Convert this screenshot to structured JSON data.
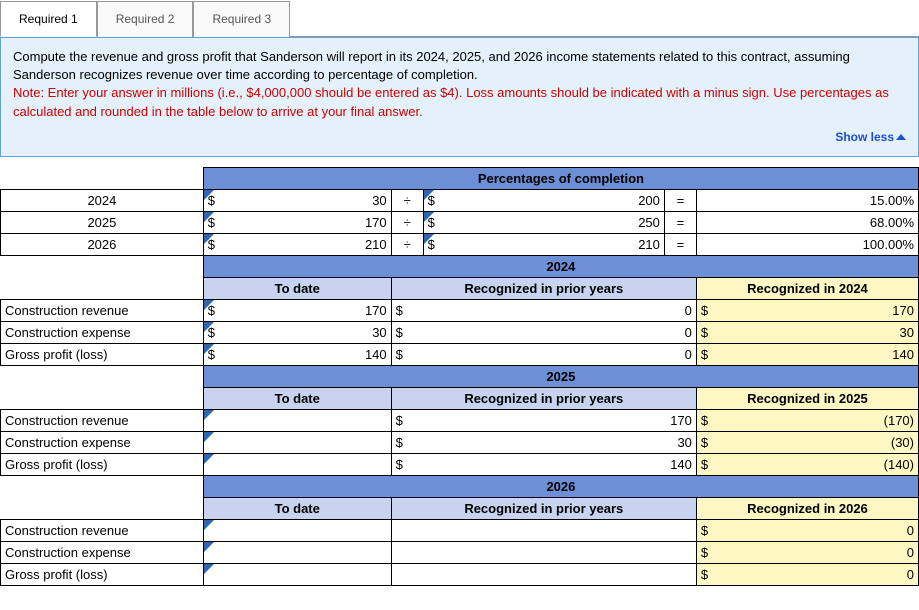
{
  "tabs": {
    "t1": "Required 1",
    "t2": "Required 2",
    "t3": "Required 3"
  },
  "prompt": {
    "p1": "Compute the revenue and gross profit that Sanderson will report in its 2024, 2025, and 2026 income statements related to this contract, assuming Sanderson recognizes revenue over time according to percentage of completion.",
    "p2": "Note: Enter your answer in millions (i.e., $4,000,000 should be entered as $4). Loss amounts should be indicated with a minus sign. Use percentages as calculated and rounded in the table below to arrive at your final answer.",
    "showless": "Show less"
  },
  "headers": {
    "poc": "Percentages of completion",
    "y2024": "2024",
    "y2025": "2025",
    "y2026": "2026",
    "todate": "To date",
    "prior": "Recognized in prior years",
    "r2024": "Recognized in 2024",
    "r2025": "Recognized in 2025",
    "r2026": "Recognized in 2026"
  },
  "rows": {
    "crev": "Construction revenue",
    "cexp": "Construction expense",
    "gp": "Gross profit (loss)"
  },
  "sym": {
    "dollar": "$",
    "div": "÷",
    "eq": "="
  },
  "poc": {
    "r24": {
      "num": "30",
      "den": "200",
      "pct": "15.00%"
    },
    "r25": {
      "num": "170",
      "den": "250",
      "pct": "68.00%"
    },
    "r26": {
      "num": "210",
      "den": "210",
      "pct": "100.00%"
    }
  },
  "y24": {
    "crev": {
      "td": "170",
      "prior": "0",
      "rec": "170"
    },
    "cexp": {
      "td": "30",
      "prior": "0",
      "rec": "30"
    },
    "gp": {
      "td": "140",
      "prior": "0",
      "rec": "140"
    }
  },
  "y25": {
    "crev": {
      "td": "",
      "prior": "170",
      "rec": "(170)"
    },
    "cexp": {
      "td": "",
      "prior": "30",
      "rec": "(30)"
    },
    "gp": {
      "td": "",
      "prior": "140",
      "rec": "(140)"
    }
  },
  "y26": {
    "crev": {
      "td": "",
      "prior": "",
      "rec": "0"
    },
    "cexp": {
      "td": "",
      "prior": "",
      "rec": "0"
    },
    "gp": {
      "td": "",
      "prior": "",
      "rec": "0"
    }
  },
  "chart_data": {
    "type": "table",
    "title": "Percentages of completion and recognized amounts by year",
    "poc": [
      {
        "year": 2024,
        "numerator": 30,
        "denominator": 200,
        "percent": 15.0
      },
      {
        "year": 2025,
        "numerator": 170,
        "denominator": 250,
        "percent": 68.0
      },
      {
        "year": 2026,
        "numerator": 210,
        "denominator": 210,
        "percent": 100.0
      }
    ],
    "revenue_profit": [
      {
        "year": 2024,
        "category": "Construction revenue",
        "to_date": 170,
        "prior": 0,
        "recognized": 170
      },
      {
        "year": 2024,
        "category": "Construction expense",
        "to_date": 30,
        "prior": 0,
        "recognized": 30
      },
      {
        "year": 2024,
        "category": "Gross profit (loss)",
        "to_date": 140,
        "prior": 0,
        "recognized": 140
      },
      {
        "year": 2025,
        "category": "Construction revenue",
        "to_date": null,
        "prior": 170,
        "recognized": -170
      },
      {
        "year": 2025,
        "category": "Construction expense",
        "to_date": null,
        "prior": 30,
        "recognized": -30
      },
      {
        "year": 2025,
        "category": "Gross profit (loss)",
        "to_date": null,
        "prior": 140,
        "recognized": -140
      },
      {
        "year": 2026,
        "category": "Construction revenue",
        "to_date": null,
        "prior": null,
        "recognized": 0
      },
      {
        "year": 2026,
        "category": "Construction expense",
        "to_date": null,
        "prior": null,
        "recognized": 0
      },
      {
        "year": 2026,
        "category": "Gross profit (loss)",
        "to_date": null,
        "prior": null,
        "recognized": 0
      }
    ]
  }
}
